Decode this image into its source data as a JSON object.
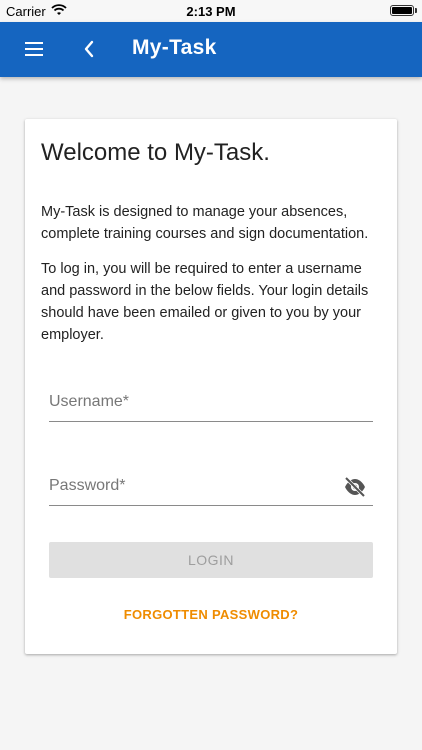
{
  "status_bar": {
    "carrier": "Carrier",
    "time": "2:13 PM"
  },
  "app_bar": {
    "title": "My-Task",
    "menu_icon": "hamburger-menu-icon",
    "back_icon": "chevron-left-icon",
    "background_color": "#1565c0"
  },
  "card": {
    "heading": "Welcome to My-Task.",
    "intro": "My-Task is designed to manage your absences, complete training courses and sign documentation.",
    "instructions": "To log in, you will be required to enter a username and password in the below fields. Your login details should have been emailed or given to you by your employer."
  },
  "form": {
    "username": {
      "placeholder": "Username*",
      "value": ""
    },
    "password": {
      "placeholder": "Password*",
      "value": "",
      "toggle_icon": "visibility-off-icon"
    },
    "login_label": "LOGIN",
    "forgot_label": "FORGOTTEN PASSWORD?"
  },
  "colors": {
    "accent": "#ef8c00",
    "disabled_button": "#e0e0e0"
  }
}
